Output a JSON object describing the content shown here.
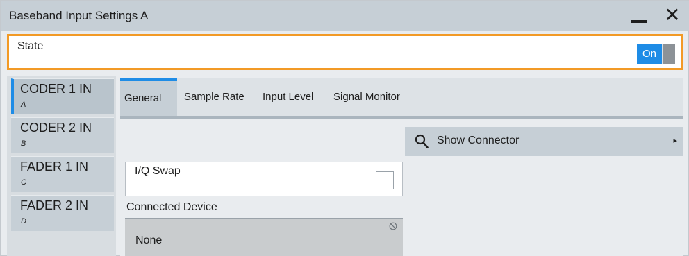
{
  "window": {
    "title": "Baseband Input Settings A",
    "minimize_icon": "minimize-icon",
    "close_label": "✕"
  },
  "state": {
    "label": "State",
    "toggle_value": "On"
  },
  "sidebar": {
    "items": [
      {
        "label": "CODER 1 IN",
        "sub": "A",
        "active": true
      },
      {
        "label": "CODER 2 IN",
        "sub": "B",
        "active": false
      },
      {
        "label": "FADER 1 IN",
        "sub": "C",
        "active": false
      },
      {
        "label": "FADER 2 IN",
        "sub": "D",
        "active": false
      }
    ]
  },
  "tabs": [
    {
      "label": "General",
      "active": true
    },
    {
      "label": "Sample Rate",
      "active": false
    },
    {
      "label": "Input Level",
      "active": false
    },
    {
      "label": "Signal Monitor",
      "active": false
    }
  ],
  "general": {
    "show_connector_label": "Show Connector",
    "show_connector_icon": "search-icon",
    "show_connector_arrow": "▸",
    "iq_swap_label": "I/Q Swap",
    "iq_swap_checked": false,
    "connected_device_label": "Connected Device",
    "connected_device_value": "None"
  },
  "colors": {
    "accent": "#1e8ce6",
    "focus_border": "#f29a26",
    "titlebar": "#c6cfd6"
  }
}
